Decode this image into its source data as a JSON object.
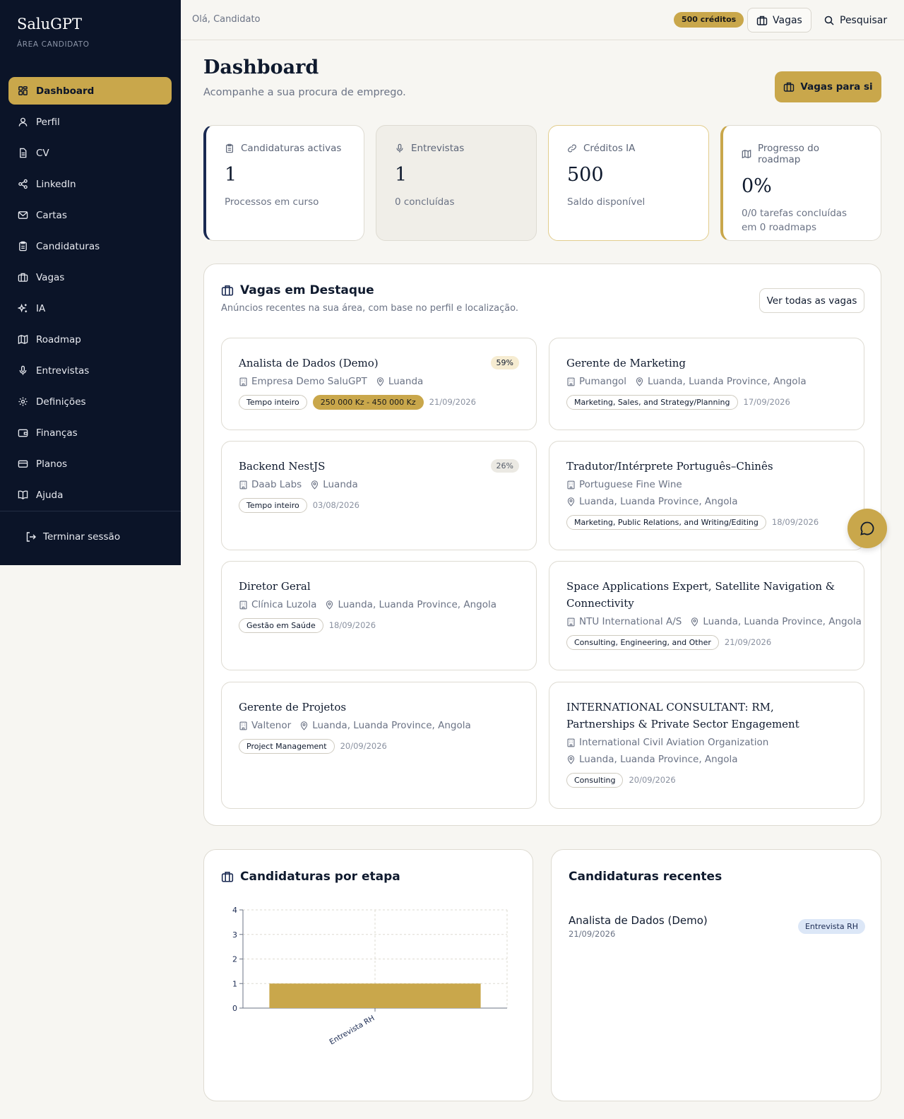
{
  "sidebar": {
    "brand": "SaluGPT",
    "subtitle": "ÁREA CANDIDATO",
    "items": [
      {
        "label": "Dashboard",
        "icon": "dashboard-icon",
        "active": true
      },
      {
        "label": "Perfil",
        "icon": "user-icon"
      },
      {
        "label": "CV",
        "icon": "file-icon"
      },
      {
        "label": "LinkedIn",
        "icon": "share-icon"
      },
      {
        "label": "Cartas",
        "icon": "mail-icon"
      },
      {
        "label": "Candidaturas",
        "icon": "clipboard-icon"
      },
      {
        "label": "Vagas",
        "icon": "briefcase-icon"
      },
      {
        "label": "IA",
        "icon": "sparkles-icon"
      },
      {
        "label": "Roadmap",
        "icon": "map-icon"
      },
      {
        "label": "Entrevistas",
        "icon": "mic-icon"
      },
      {
        "label": "Definições",
        "icon": "gear-icon"
      },
      {
        "label": "Finanças",
        "icon": "wallet-icon"
      },
      {
        "label": "Planos",
        "icon": "credit-card-icon"
      },
      {
        "label": "Ajuda",
        "icon": "book-icon"
      }
    ],
    "logout": "Terminar sessão"
  },
  "header": {
    "greeting": "Olá, Candidato",
    "credits": "500 créditos",
    "vagas": "Vagas",
    "search": "Pesquisar"
  },
  "page": {
    "title": "Dashboard",
    "subtitle": "Acompanhe a sua procura de emprego.",
    "cta": "Vagas para si"
  },
  "stats": [
    {
      "label": "Candidaturas activas",
      "value": "1",
      "note": "Processos em curso",
      "icon": "clipboard-icon"
    },
    {
      "label": "Entrevistas",
      "value": "1",
      "note": "0 concluídas",
      "icon": "mic-icon"
    },
    {
      "label": "Créditos IA",
      "value": "500",
      "note": "Saldo disponível",
      "icon": "link-icon"
    },
    {
      "label": "Progresso do roadmap",
      "value": "0%",
      "note": "0/0 tarefas concluídas em 0 roadmaps",
      "icon": "map-icon"
    }
  ],
  "featured": {
    "title": "Vagas em Destaque",
    "subtitle": "Anúncios recentes na sua área, com base no perfil e localização.",
    "view_all": "Ver todas as vagas",
    "jobs": [
      {
        "title": "Analista de Dados (Demo)",
        "company": "Empresa Demo SaluGPT",
        "location": "Luanda",
        "tags": [
          "Tempo inteiro"
        ],
        "salary": "250 000 Kz - 450 000 Kz",
        "date": "21/09/2026",
        "match": "59%"
      },
      {
        "title": "Gerente de Marketing",
        "company": "Pumangol",
        "location": "Luanda, Luanda Province, Angola",
        "tags": [
          "Marketing, Sales, and Strategy/Planning"
        ],
        "date": "17/09/2026"
      },
      {
        "title": "Backend NestJS",
        "company": "Daab Labs",
        "location": "Luanda",
        "tags": [
          "Tempo inteiro"
        ],
        "date": "03/08/2026",
        "match": "26%"
      },
      {
        "title": "Tradutor/Intérprete Português–Chinês",
        "company": "Portuguese Fine Wine",
        "location": "Luanda, Luanda Province, Angola",
        "tags": [
          "Marketing, Public Relations, and Writing/Editing"
        ],
        "date": "18/09/2026"
      },
      {
        "title": "Diretor Geral",
        "company": "Clínica Luzola",
        "location": "Luanda, Luanda Province, Angola",
        "tags": [
          "Gestão em Saúde"
        ],
        "date": "18/09/2026"
      },
      {
        "title": "Space Applications Expert, Satellite Navigation & Connectivity",
        "company": "NTU International A/S",
        "location": "Luanda, Luanda Province, Angola",
        "tags": [
          "Consulting, Engineering, and Other"
        ],
        "date": "21/09/2026"
      },
      {
        "title": "Gerente de Projetos",
        "company": "Valtenor",
        "location": "Luanda, Luanda Province, Angola",
        "tags": [
          "Project Management"
        ],
        "date": "20/09/2026"
      },
      {
        "title": "INTERNATIONAL CONSULTANT: RM, Partnerships & Private Sector Engagement",
        "company": "International Civil Aviation Organization",
        "location": "Luanda, Luanda Province, Angola",
        "tags": [
          "Consulting"
        ],
        "date": "20/09/2026"
      }
    ]
  },
  "pipeline": {
    "title": "Candidaturas por etapa"
  },
  "chart_data": {
    "type": "bar",
    "categories": [
      "Entrevista RH"
    ],
    "values": [
      1
    ],
    "ylim": [
      0,
      4
    ],
    "yticks": [
      "0",
      "1",
      "2",
      "3",
      "4"
    ],
    "grid": true,
    "color": "#c9a74b"
  },
  "recent": {
    "title": "Candidaturas recentes",
    "items": [
      {
        "title": "Analista de Dados (Demo)",
        "date": "21/09/2026",
        "status": "Entrevista RH"
      }
    ]
  },
  "colors": {
    "sidebar_bg": "#0b1428",
    "accent_gold": "#c9a74b",
    "page_bg": "#f7f6f2",
    "navy": "#1a2a52"
  }
}
